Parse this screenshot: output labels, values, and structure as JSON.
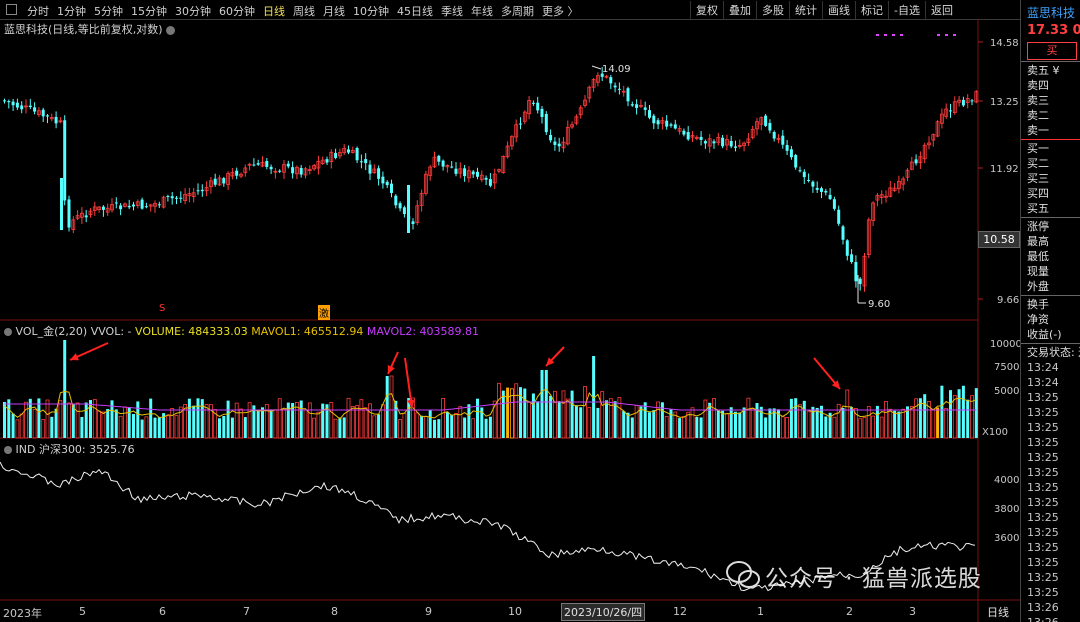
{
  "toolbar": {
    "periods": [
      "分时",
      "1分钟",
      "5分钟",
      "15分钟",
      "30分钟",
      "60分钟",
      "日线",
      "周线",
      "月线",
      "10分钟",
      "45日线",
      "季线",
      "年线",
      "多周期",
      "更多 〉"
    ],
    "active_period": "日线",
    "tools": [
      "复权",
      "叠加",
      "多股",
      "统计",
      "画线",
      "标记",
      "-自选",
      "返回"
    ]
  },
  "stock": {
    "header": "蓝思科技(日线,等比前复权,对数)",
    "price_axis": [
      "14.58",
      "13.25",
      "11.92",
      "10.58",
      "9.66"
    ],
    "current_price": "10.58",
    "high_label": "14.09",
    "low_label": "9.60",
    "markers": {
      "s": "S",
      "ji": "激"
    }
  },
  "volume": {
    "label_prefix": "VOL_金(2,20)  VVOL: -",
    "volume_label": "VOLUME: 484333.03",
    "mavol1_label": "MAVOL1: 465512.94",
    "mavol2_label": "MAVOL2: 403589.81",
    "axis": [
      "10000",
      "7500",
      "5000",
      "X100"
    ]
  },
  "index": {
    "label": "IND 沪深300: 3525.76",
    "axis": [
      "4000",
      "3800",
      "3600"
    ]
  },
  "dates": [
    "2023年",
    "5",
    "6",
    "7",
    "8",
    "9",
    "10",
    "12",
    "1",
    "2",
    "3"
  ],
  "cursor_date": "2023/10/26/四",
  "period_label": "日线",
  "right_panel": {
    "title": "蓝思科技",
    "price": "17.33  0.3",
    "buy_label": "买",
    "sell_rows": [
      "卖五 ¥",
      "卖四",
      "卖三",
      "卖二",
      "卖一"
    ],
    "buy_rows": [
      "买一",
      "买二",
      "买三",
      "买四",
      "买五"
    ],
    "stats": [
      "涨停",
      "最高",
      "最低",
      "现量",
      "外盘"
    ],
    "stats2": [
      "换手",
      "净资",
      "收益(-)"
    ],
    "trade_status": "交易状态: 连",
    "times": [
      "13:24",
      "13:24",
      "13:25",
      "13:25",
      "13:25",
      "13:25",
      "13:25",
      "13:25",
      "13:25",
      "13:25",
      "13:25",
      "13:25",
      "13:25",
      "13:25",
      "13:25",
      "13:25",
      "13:26",
      "13:26"
    ]
  },
  "watermark": "公众号 · 猛兽派选股",
  "colors": {
    "up": "#ff3c3c",
    "down": "#55ffff",
    "ma1": "#e8c000",
    "ma2": "#c83cff",
    "index": "#f0f0f0",
    "arrow": "#ff2020"
  }
}
